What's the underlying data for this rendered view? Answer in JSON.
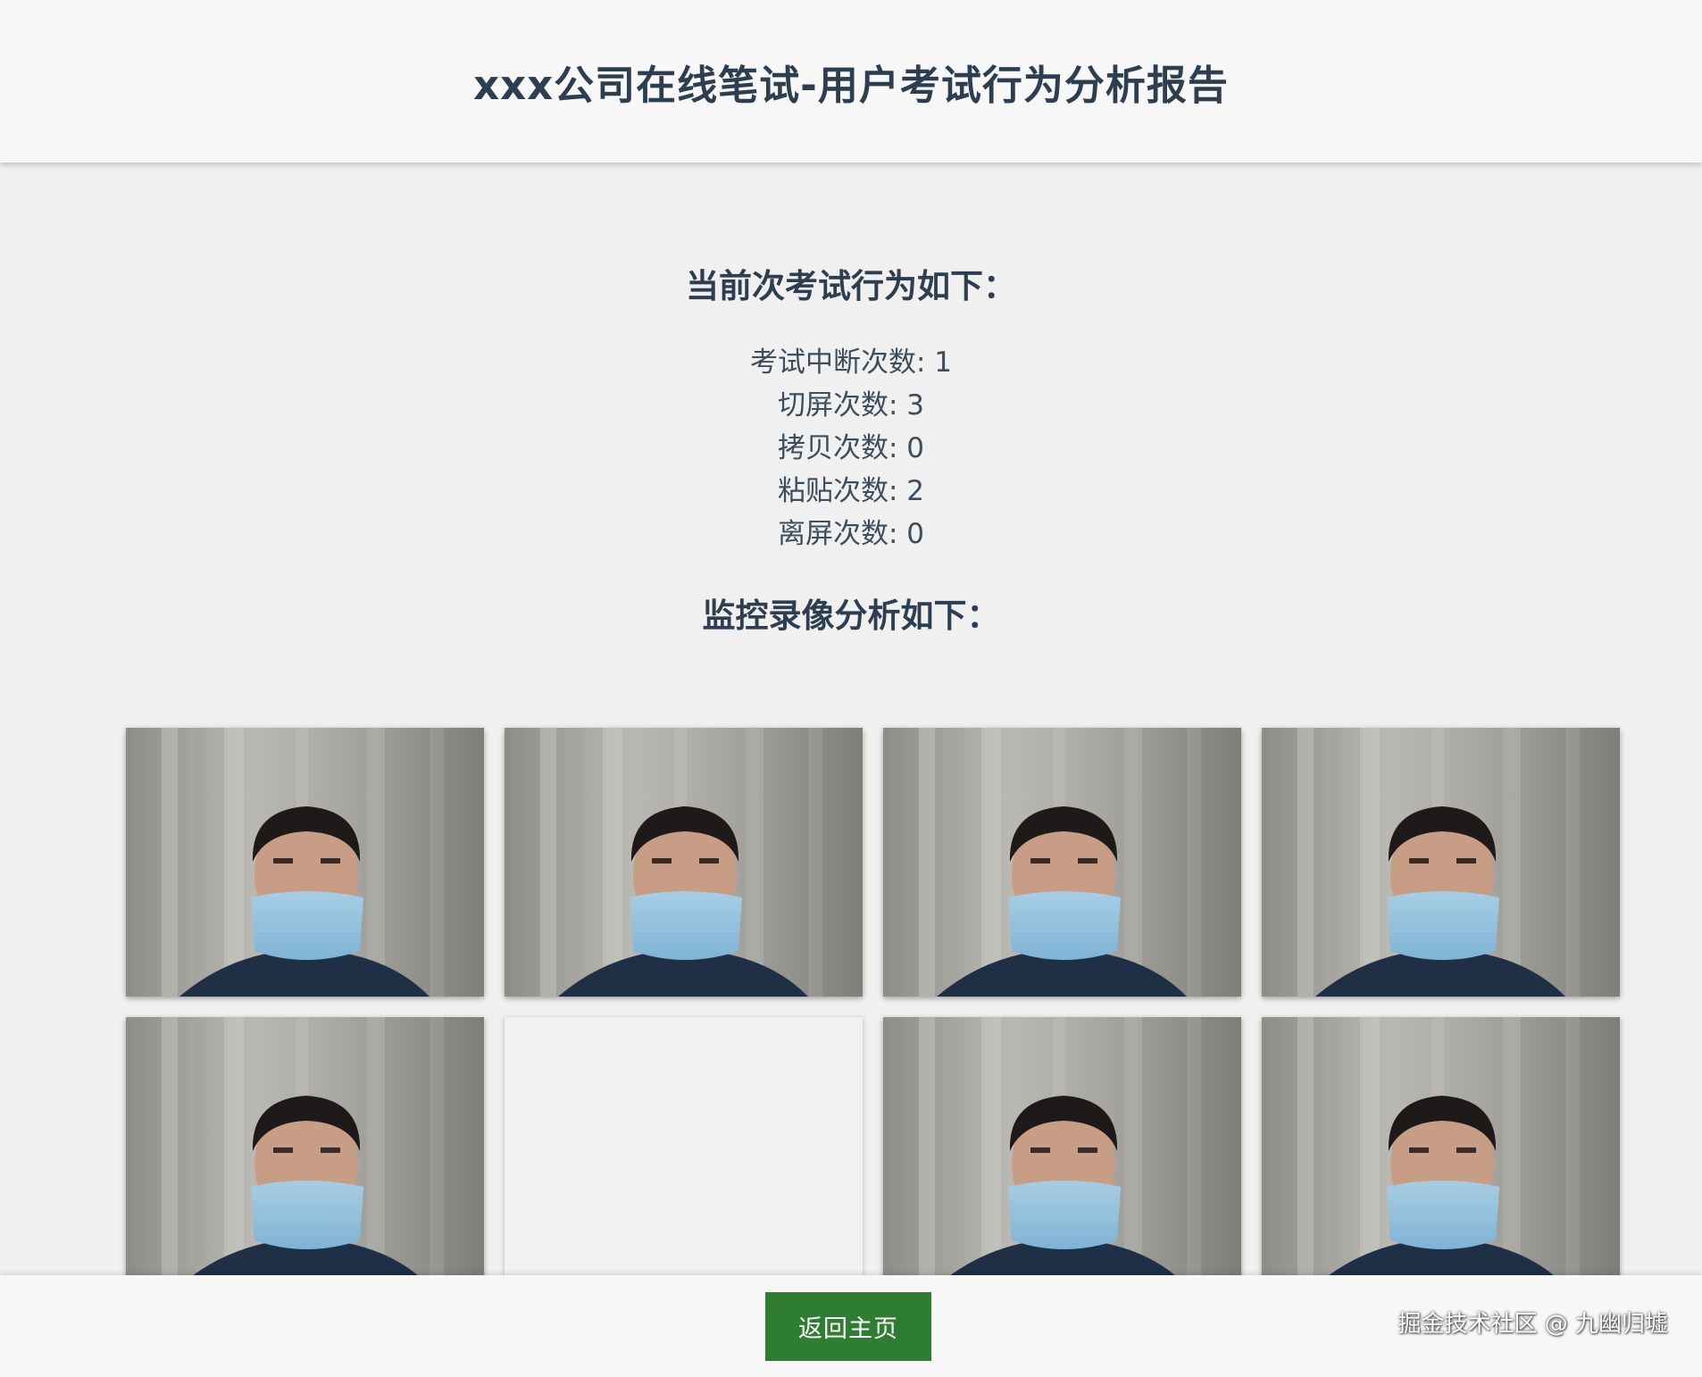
{
  "header": {
    "title": "xxx公司在线笔试-用户考试行为分析报告"
  },
  "behavior": {
    "title": "当前次考试行为如下：",
    "stats": [
      {
        "label": "考试中断次数",
        "value": "1"
      },
      {
        "label": "切屏次数",
        "value": "3"
      },
      {
        "label": "拷贝次数",
        "value": "0"
      },
      {
        "label": "粘贴次数",
        "value": "2"
      },
      {
        "label": "离屏次数",
        "value": "0"
      }
    ]
  },
  "monitor": {
    "title": "监控录像分析如下：",
    "frames": [
      {
        "has_image": true
      },
      {
        "has_image": true
      },
      {
        "has_image": true
      },
      {
        "has_image": true
      },
      {
        "has_image": true
      },
      {
        "has_image": false
      },
      {
        "has_image": true
      },
      {
        "has_image": true
      }
    ]
  },
  "footer": {
    "back_label": "返回主页",
    "watermark": "掘金技术社区 @ 九幽归墟"
  },
  "colors": {
    "button": "#2e7d32",
    "text": "#2c3e50",
    "background": "#f0f0f0"
  }
}
